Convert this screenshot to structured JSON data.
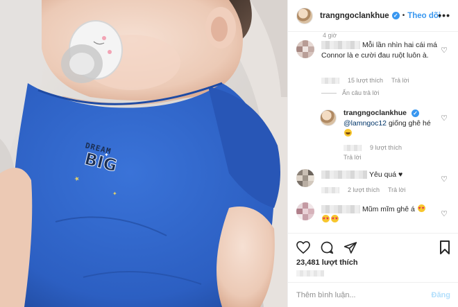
{
  "post": {
    "image_alt": "Baby sleeping in a blue bodysuit with a pacifier",
    "shirt_print": {
      "line1": "DREAM",
      "line2": "BIG"
    }
  },
  "header": {
    "username": "trangngoclankhue",
    "follow_label": "Theo dõi",
    "dot": "•",
    "more": "•••"
  },
  "comments": {
    "first_time": "4 giờ",
    "items": [
      {
        "text": "Mỗi lần nhìn hai cái má Connor là e cười đau ruột luôn à.",
        "likes": "15 lượt thích",
        "reply_label": "Trả lời",
        "hide_replies": "Ẩn câu trả lời"
      },
      {
        "username": "trangngoclankhue",
        "mention": "@lamngoc12",
        "text": " giống ghê hé ",
        "likes": "9 lượt thích",
        "reply_label": "Trả lời"
      },
      {
        "text": "Yêu quá ♥",
        "likes": "2 lượt thích",
        "reply_label": "Trả lời"
      },
      {
        "text": "Mũm mĩm ghê á"
      }
    ]
  },
  "actions": {
    "likes_count": "23,481 lượt thích"
  },
  "comment_box": {
    "placeholder": "Thêm bình luận...",
    "post_label": "Đăng"
  },
  "colors": {
    "accent": "#3897f0",
    "shirt": "#2f63c8",
    "text": "#262626",
    "muted": "#8e8e8e"
  }
}
